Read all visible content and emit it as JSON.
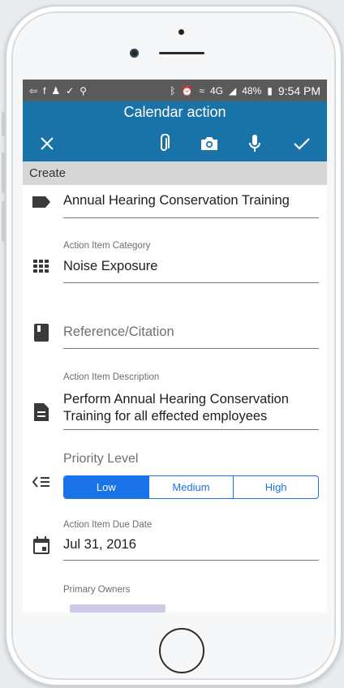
{
  "status": {
    "battery": "48%",
    "time": "9:54 PM",
    "network": "4G"
  },
  "appbar": {
    "title": "Calendar action",
    "icons": [
      "close-icon",
      "attach-icon",
      "camera-icon",
      "mic-icon",
      "check-icon"
    ]
  },
  "subheader": "Create",
  "form": {
    "title_value": "Annual Hearing Conservation Training",
    "category": {
      "label": "Action Item Category",
      "value": "Noise Exposure"
    },
    "reference": {
      "placeholder": "Reference/Citation"
    },
    "description": {
      "label": "Action Item Description",
      "line1": "Perform Annual Hearing Conservation",
      "line2": "Training for all effected employees"
    },
    "priority": {
      "label": "Priority Level",
      "options": [
        "Low",
        "Medium",
        "High"
      ],
      "selected": "Low"
    },
    "due_date": {
      "label": "Action Item Due Date",
      "value": "Jul 31, 2016"
    },
    "owners": {
      "label": "Primary Owners"
    }
  },
  "colors": {
    "appbar": "#1a73a8",
    "statusbar": "#5a5a5a",
    "accent": "#1a73e8",
    "subheader_bg": "#d7d7d7"
  }
}
